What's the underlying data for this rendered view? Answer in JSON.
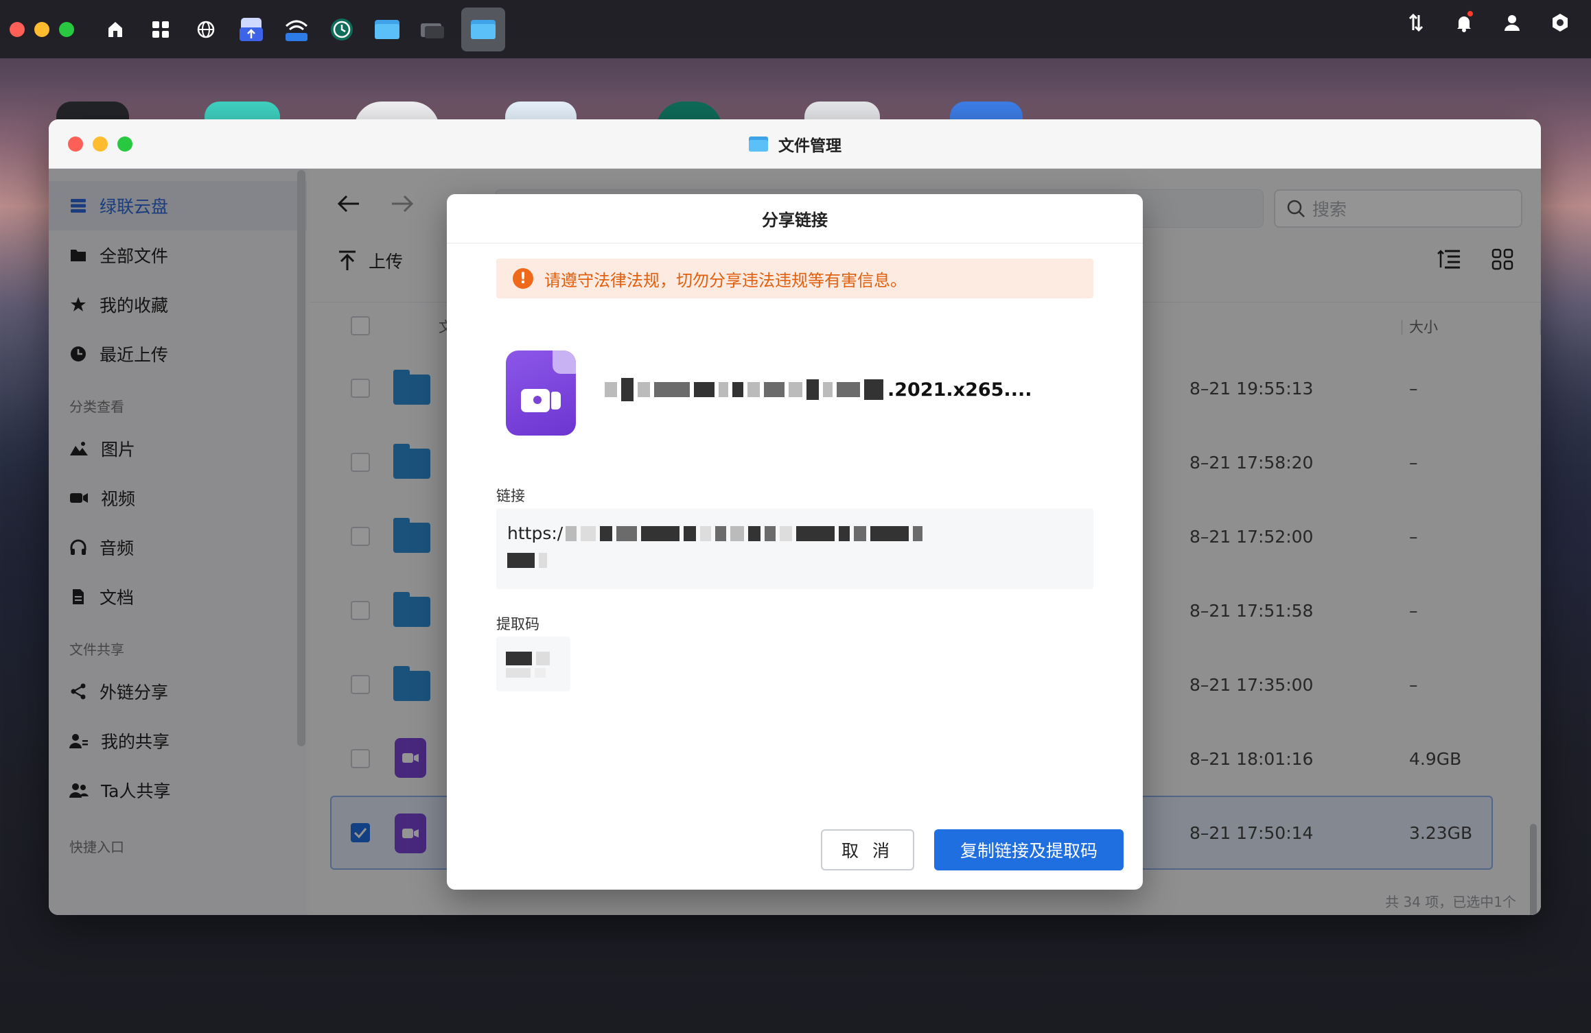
{
  "colors": {
    "accent": "#1f6fe0",
    "warning": "#e0600f",
    "folder": "#2f8ed6",
    "video": "#7a45d6"
  },
  "topbar": {
    "icons": [
      "home-icon",
      "apps-grid-icon",
      "globe-icon",
      "cloud-upload-icon",
      "wifi-storage-icon",
      "time-machine-icon",
      "file-manager-icon",
      "drive-icon",
      "file-manager-active-icon"
    ],
    "right_icons": [
      "transfer-icon",
      "bell-icon",
      "user-icon",
      "settings-icon"
    ]
  },
  "window": {
    "title": "文件管理"
  },
  "sidebar": {
    "active": "绿联云盘",
    "items_main": [
      "全部文件",
      "我的收藏",
      "最近上传"
    ],
    "group_category": "分类查看",
    "items_category": [
      "图片",
      "视频",
      "音频",
      "文档"
    ],
    "group_share": "文件共享",
    "items_share": [
      "外链分享",
      "我的共享",
      "Ta人共享"
    ],
    "group_quick": "快捷入口"
  },
  "content": {
    "search_placeholder": "搜索",
    "upload_label": "上传",
    "col_name": "文件名",
    "col_size": "大小",
    "rows": [
      {
        "date": "8–21 19:55:13",
        "size": "–"
      },
      {
        "date": "8–21 17:58:20",
        "size": "–"
      },
      {
        "date": "8–21 17:52:00",
        "size": "–"
      },
      {
        "date": "8–21 17:51:58",
        "size": "–"
      },
      {
        "date": "8–21 17:35:00",
        "size": "–"
      },
      {
        "date": "8–21 18:01:16",
        "size": "4.9GB"
      },
      {
        "date": "8–21 17:50:14",
        "size": "3.23GB"
      }
    ],
    "status": "共 34 项，已选中1个"
  },
  "dialog": {
    "title": "分享链接",
    "warning": "请遵守法律法规，切勿分享违法违规等有害信息。",
    "file_name_suffix": ".2021.x265....",
    "link_label": "链接",
    "link_prefix": "https:/",
    "code_label": "提取码",
    "cancel": "取 消",
    "copy": "复制链接及提取码"
  }
}
